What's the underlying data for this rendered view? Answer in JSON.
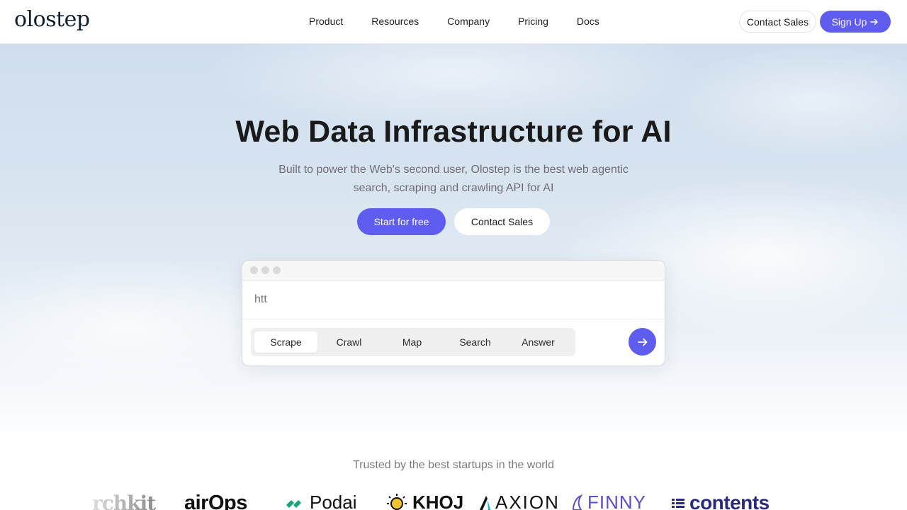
{
  "header": {
    "logo": "olostep",
    "nav": [
      {
        "label": "Product"
      },
      {
        "label": "Resources"
      },
      {
        "label": "Company"
      },
      {
        "label": "Pricing"
      },
      {
        "label": "Docs"
      }
    ],
    "contact_label": "Contact Sales",
    "signup_label": "Sign Up"
  },
  "hero": {
    "title": "Web Data Infrastructure for AI",
    "subtitle": "Built to power the Web's second user, Olostep is the best web agentic search, scraping and crawling API for AI",
    "cta_primary": "Start for free",
    "cta_secondary": "Contact Sales"
  },
  "demo": {
    "input_value": "htt",
    "tabs": [
      {
        "label": "Scrape",
        "active": true
      },
      {
        "label": "Crawl"
      },
      {
        "label": "Map"
      },
      {
        "label": "Search"
      },
      {
        "label": "Answer"
      }
    ],
    "submit_icon": "arrow-right-icon"
  },
  "trusted": {
    "heading": "Trusted by the best startups in the world",
    "logos": [
      "rchkit",
      "airOps",
      "Podai",
      "KHOJ",
      "AXION",
      "FINNY",
      "contents"
    ]
  },
  "colors": {
    "accent": "#5e5df0",
    "sky_top": "#cfdeee",
    "text_muted": "#6d6f75"
  }
}
